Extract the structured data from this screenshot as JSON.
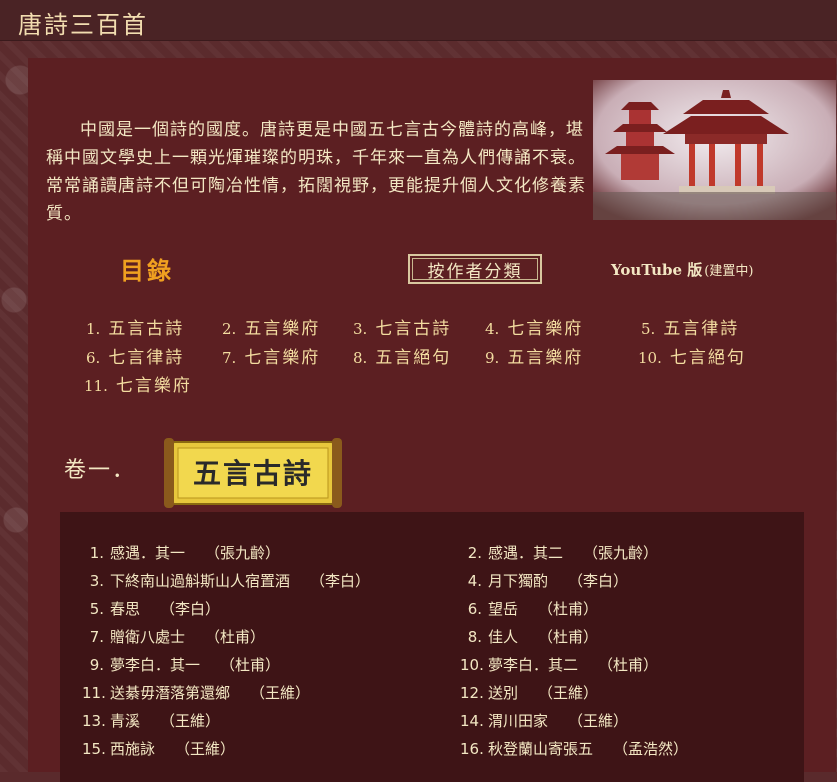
{
  "site": {
    "title": "唐詩三百首"
  },
  "intro": {
    "text": "中國是一個詩的國度。唐詩更是中國五七言古今體詩的高峰，堪稱中國文學史上一顆光煇璀璨的明珠，千年來一直為人們傳誦不衰。常常誦讀唐詩不但可陶冶性情，拓闊視野，更能提升個人文化修養素質。"
  },
  "toc": {
    "heading": "目錄",
    "author_button": "按作者分類",
    "youtube_label": "YouTube 版",
    "youtube_note": "(建置中)",
    "items": [
      {
        "num": "1.",
        "label": "五言古詩"
      },
      {
        "num": "2.",
        "label": "五言樂府"
      },
      {
        "num": "3.",
        "label": "七言古詩"
      },
      {
        "num": "4.",
        "label": "七言樂府"
      },
      {
        "num": "5.",
        "label": "五言律詩"
      },
      {
        "num": "6.",
        "label": "七言律詩"
      },
      {
        "num": "7.",
        "label": "七言樂府"
      },
      {
        "num": "8.",
        "label": "五言絕句"
      },
      {
        "num": "9.",
        "label": "五言樂府"
      },
      {
        "num": "10.",
        "label": "七言絕句"
      },
      {
        "num": "11.",
        "label": "七言樂府"
      }
    ]
  },
  "volume": {
    "label": "卷一．",
    "banner": "五言古詩"
  },
  "poems": [
    {
      "num": "1.",
      "title": "感遇．其一",
      "author": "（張九齡）"
    },
    {
      "num": "2.",
      "title": "感遇．其二",
      "author": "（張九齡）"
    },
    {
      "num": "3.",
      "title": "下終南山過斛斯山人宿置酒",
      "author": "（李白）"
    },
    {
      "num": "4.",
      "title": "月下獨酌",
      "author": "（李白）"
    },
    {
      "num": "5.",
      "title": "春思",
      "author": "（李白）"
    },
    {
      "num": "6.",
      "title": "望岳",
      "author": "（杜甫）"
    },
    {
      "num": "7.",
      "title": "贈衛八處士",
      "author": "（杜甫）"
    },
    {
      "num": "8.",
      "title": "佳人",
      "author": "（杜甫）"
    },
    {
      "num": "9.",
      "title": "夢李白．其一",
      "author": "（杜甫）"
    },
    {
      "num": "10.",
      "title": "夢李白．其二",
      "author": "（杜甫）"
    },
    {
      "num": "11.",
      "title": "送綦毋潛落第還鄉",
      "author": "（王維）"
    },
    {
      "num": "12.",
      "title": "送別",
      "author": "（王維）"
    },
    {
      "num": "13.",
      "title": "青溪",
      "author": "（王維）"
    },
    {
      "num": "14.",
      "title": "渭川田家",
      "author": "（王維）"
    },
    {
      "num": "15.",
      "title": "西施詠",
      "author": "（王維）"
    },
    {
      "num": "16.",
      "title": "秋登蘭山寄張五",
      "author": "（孟浩然）"
    }
  ],
  "colors": {
    "background": "#5b2b2d",
    "panel": "#5c1f22",
    "poem_box": "#3e1416",
    "heading": "#f0a020",
    "text": "#f3e7c3"
  }
}
